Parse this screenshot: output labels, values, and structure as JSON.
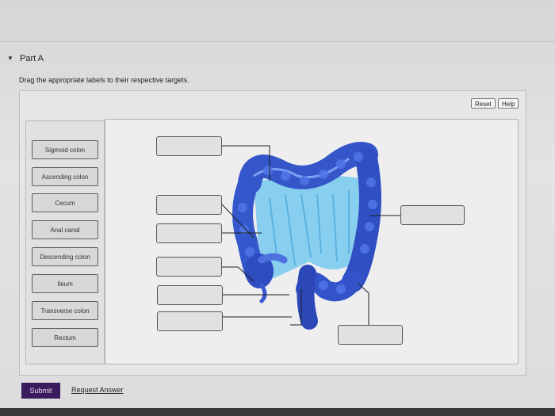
{
  "part": {
    "title": "Part A"
  },
  "instructions": "Drag the appropriate labels to their respective targets.",
  "toolbar": {
    "reset_label": "Reset",
    "help_label": "Help"
  },
  "labels": [
    "Sigmoid colon",
    "Ascending colon",
    "Cecum",
    "Anal canal",
    "Descending colon",
    "Ileum",
    "Transverse colon",
    "Rectum"
  ],
  "footer": {
    "submit_label": "Submit",
    "request_label": "Request Answer"
  },
  "colors": {
    "submit_bg": "#3a1c5e",
    "colon": "#3a5fcf",
    "mesentery": "#6fc7ee"
  }
}
